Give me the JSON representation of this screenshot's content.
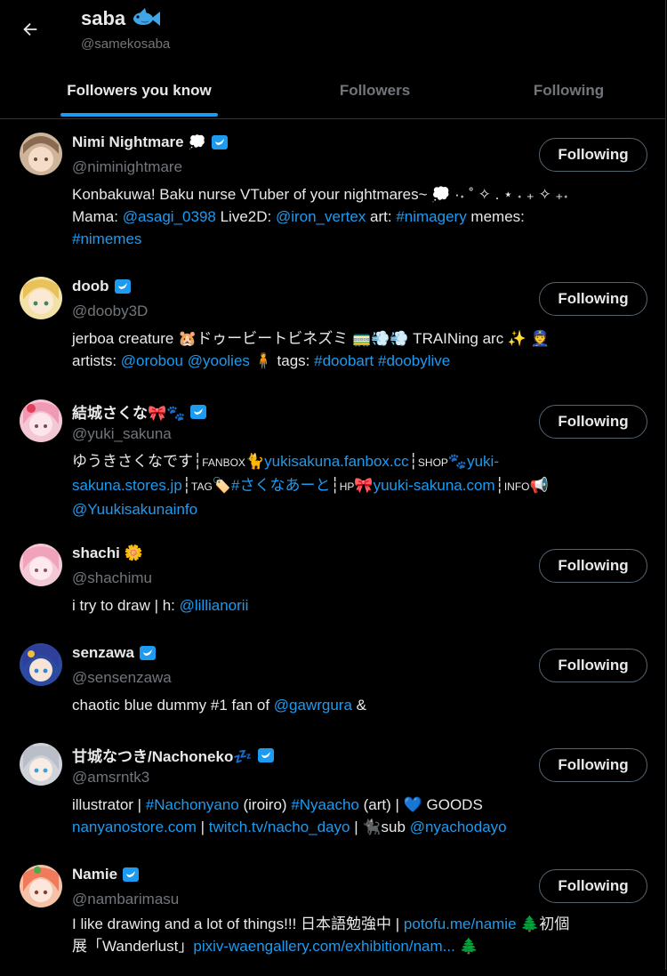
{
  "header": {
    "title": "saba",
    "handle": "@samekosaba"
  },
  "tabs": [
    {
      "label": "Followers you know"
    },
    {
      "label": "Followers"
    },
    {
      "label": "Following"
    }
  ],
  "users": [
    {
      "name": "Nimi Nightmare",
      "handle": "@niminightmare",
      "button": "Following",
      "bio": [
        [
          {
            "t": "Konbakuwa! Baku nurse VTuber of your nightmares~ 💭 ·˖ ˚ ✧ . ⋆ ˖ ₊ ✧ ₊˖"
          }
        ],
        [
          {
            "t": "Mama: "
          },
          {
            "t": "@asagi_0398",
            "l": true
          },
          {
            "t": " Live2D: "
          },
          {
            "t": "@iron_vertex",
            "l": true
          },
          {
            "t": " art: "
          },
          {
            "t": "#nimagery",
            "l": true
          },
          {
            "t": " memes:"
          }
        ],
        [
          {
            "t": "#nimemes",
            "l": true
          }
        ]
      ]
    },
    {
      "name": "doob",
      "handle": "@dooby3D",
      "button": "Following",
      "bio": [
        [
          {
            "t": "jerboa creature 🐹ドゥービートビネズミ 🚃💨💨 TRAINing arc ✨ 👮"
          }
        ],
        [
          {
            "t": "artists: "
          },
          {
            "t": "@orobou",
            "l": true
          },
          {
            "t": " "
          },
          {
            "t": "@yoolies",
            "l": true
          },
          {
            "t": " 🧍 tags: "
          },
          {
            "t": "#doobart",
            "l": true
          },
          {
            "t": " "
          },
          {
            "t": "#doobylive",
            "l": true
          }
        ]
      ]
    },
    {
      "name": "結城さくな🎀🐾",
      "handle": "@yuki_sakuna",
      "button": "Following",
      "bio": [
        [
          {
            "t": "ゆうきさくなです┆"
          },
          {
            "t": "FANBOX",
            "s": true
          },
          {
            "t": "🐈"
          },
          {
            "t": "yukisakuna.fanbox.cc",
            "l": true
          },
          {
            "t": "┆"
          },
          {
            "t": "SHOP",
            "s": true
          },
          {
            "t": "🐾"
          },
          {
            "t": "yuki-",
            "l": true
          }
        ],
        [
          {
            "t": "sakuna.stores.jp",
            "l": true
          },
          {
            "t": "┆"
          },
          {
            "t": "TAG",
            "s": true
          },
          {
            "t": "🏷️"
          },
          {
            "t": "#さくなあーと",
            "l": true
          },
          {
            "t": "┆"
          },
          {
            "t": "HP",
            "s": true
          },
          {
            "t": "🎀"
          },
          {
            "t": "yuuki-sakuna.com",
            "l": true
          },
          {
            "t": "┆"
          },
          {
            "t": "INFO",
            "s": true
          },
          {
            "t": "📢"
          }
        ],
        [
          {
            "t": "@Yuukisakunainfo",
            "l": true
          }
        ]
      ]
    },
    {
      "name": "shachi 🌼",
      "handle": "@shachimu",
      "button": "Following",
      "bio": [
        [
          {
            "t": "i try to draw | h: "
          },
          {
            "t": "@lillianorii",
            "l": true
          }
        ]
      ]
    },
    {
      "name": "senzawa",
      "handle": "@sensenzawa",
      "button": "Following",
      "bio": [
        [
          {
            "t": "chaotic blue dummy #1 fan of "
          },
          {
            "t": "@gawrgura",
            "l": true
          },
          {
            "t": " &"
          }
        ]
      ]
    },
    {
      "name": "甘城なつき/Nachoneko💤",
      "handle": "@amsrntk3",
      "button": "Following",
      "bio": [
        [
          {
            "t": "illustrator | "
          },
          {
            "t": "#Nachonyano",
            "l": true
          },
          {
            "t": " (iroiro) "
          },
          {
            "t": "#Nyaacho",
            "l": true
          },
          {
            "t": " (art) | 💙 GOODS"
          }
        ],
        [
          {
            "t": "nanyanostore.com",
            "l": true
          },
          {
            "t": "  |  "
          },
          {
            "t": "twitch.tv/nacho_dayo",
            "l": true
          },
          {
            "t": "  | 🐈‍⬛sub "
          },
          {
            "t": "@nyachodayo",
            "l": true
          }
        ]
      ]
    },
    {
      "name": "Namie",
      "handle": "@nambarimasu",
      "button": "Following",
      "bio": [
        [
          {
            "t": "I like drawing and a lot of things!!! 日本語勉強中 | "
          },
          {
            "t": "potofu.me/namie",
            "l": true
          },
          {
            "t": " 🌲初個"
          }
        ],
        [
          {
            "t": "展「Wanderlust」"
          },
          {
            "t": "pixiv-waengallery.com/exhibition/nam...",
            "l": true
          },
          {
            "t": " 🌲"
          }
        ]
      ]
    }
  ],
  "colors": {
    "accent": "#1d9bf0",
    "text": "#e7e9ea",
    "muted": "#71767b",
    "border": "#2f3336"
  }
}
